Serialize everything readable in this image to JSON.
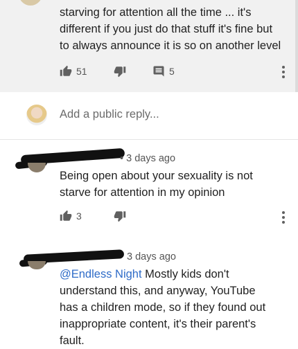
{
  "parent_comment": {
    "text_lines": [
      "starving for attention all the time ... it's",
      "different if you just do that stuff it's fine but",
      "to always announce it is so on another level"
    ],
    "likes": "51",
    "replies": "5"
  },
  "reply_box": {
    "placeholder": "Add a public reply..."
  },
  "replies": [
    {
      "timestamp": "• 3 days ago",
      "text_lines": [
        "Being open about your sexuality is not",
        "starve for attention in my opinion"
      ],
      "likes": "3"
    },
    {
      "timestamp": "3 days ago",
      "mention": "@Endless Night",
      "text_lines": [
        " Mostly kids don't",
        "understand this, and anyway, YouTube",
        "has a children mode, so if they found out",
        "inappropriate content, it's their parent's",
        "fault."
      ]
    }
  ],
  "icons": {
    "like": "thumbs-up-icon",
    "dislike": "thumbs-down-icon",
    "reply": "comment-icon",
    "more": "more-vert-icon"
  },
  "colors": {
    "mention": "#2f6cc8",
    "top_bg": "#f1f1f1"
  }
}
